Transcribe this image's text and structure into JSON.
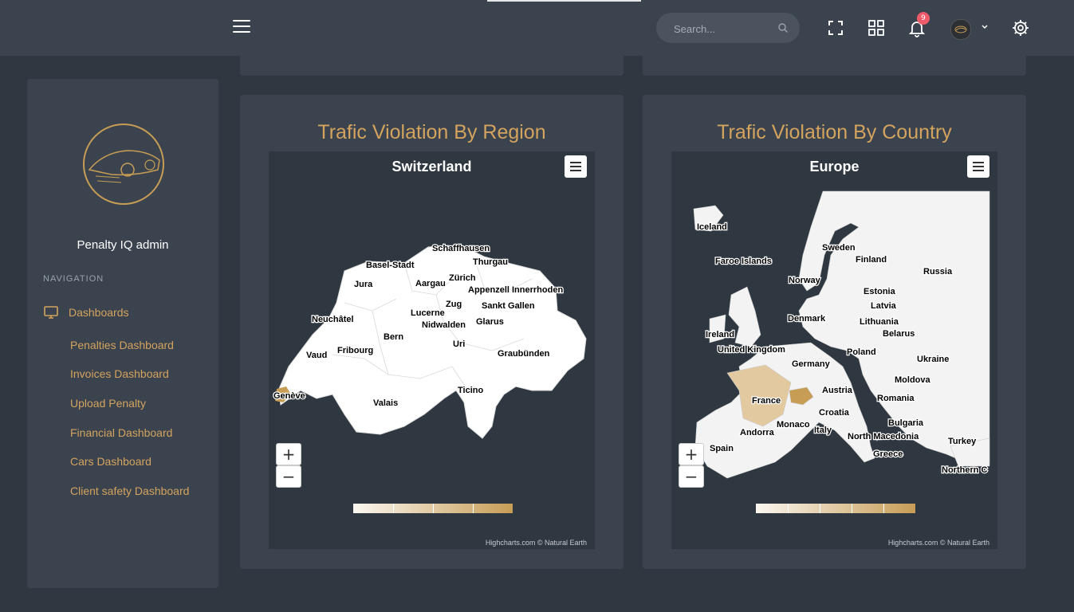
{
  "header": {
    "search_placeholder": "Search...",
    "notification_count": "9",
    "icons": [
      "menu-icon",
      "search-icon",
      "fullscreen-icon",
      "apps-grid-icon",
      "bell-icon",
      "chevron-down-icon",
      "gear-icon"
    ]
  },
  "sidebar": {
    "username": "Penalty IQ admin",
    "nav_title": "NAVIGATION",
    "main_item": "Dashboards",
    "items": [
      {
        "label": "Penalties Dashboard"
      },
      {
        "label": "Invoices Dashboard"
      },
      {
        "label": "Upload Penalty"
      },
      {
        "label": "Financial Dashboard"
      },
      {
        "label": "Cars Dashboard"
      },
      {
        "label": "Client safety Dashboard"
      }
    ]
  },
  "region_card": {
    "heading": "Trafic Violation By Region",
    "map_title": "Switzerland",
    "credits": "Highcharts.com © Natural Earth",
    "labels": [
      "Schaffhausen",
      "Basel-Stadt",
      "Thurgau",
      "Jura",
      "Zürich",
      "Aargau",
      "Appenzell Innerrhoden",
      "Sankt Gallen",
      "Zug",
      "Lucerne",
      "Neuchâtel",
      "Nidwalden",
      "Glarus",
      "Bern",
      "Uri",
      "Fribourg",
      "Vaud",
      "Graubünden",
      "Genève",
      "Ticino",
      "Valais"
    ]
  },
  "country_card": {
    "heading": "Trafic Violation By Country",
    "map_title": "Europe",
    "credits": "Highcharts.com © Natural Earth",
    "labels": [
      "Iceland",
      "Sweden",
      "Finland",
      "Faroe Islands",
      "Russia",
      "Norway",
      "Estonia",
      "Latvia",
      "Denmark",
      "Lithuania",
      "Ireland",
      "Belarus",
      "United Kingdom",
      "Poland",
      "Germany",
      "Ukraine",
      "Moldova",
      "France",
      "Austria",
      "Romania",
      "Croatia",
      "Bulgaria",
      "Monaco",
      "Andorra",
      "Italy",
      "North Macedonia",
      "Spain",
      "Turkey",
      "Greece",
      "Northern C"
    ]
  },
  "colors": {
    "accent": "#d4a35e",
    "background": "#2f3741",
    "panel": "#3a434e",
    "legend_low": "#fbf7f1",
    "legend_high": "#c79d56",
    "highlight_country": "#e3c9a0",
    "highlight_region": "#c79d56"
  }
}
